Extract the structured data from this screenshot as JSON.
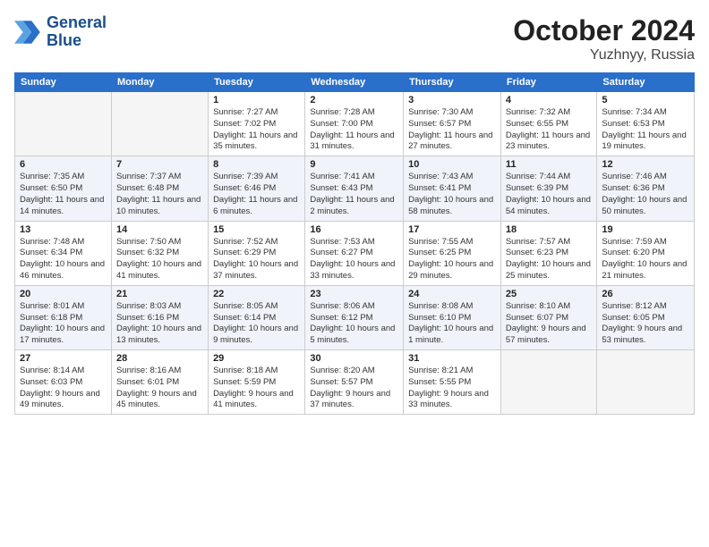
{
  "header": {
    "logo_line1": "General",
    "logo_line2": "Blue",
    "month": "October 2024",
    "location": "Yuzhnyy, Russia"
  },
  "weekdays": [
    "Sunday",
    "Monday",
    "Tuesday",
    "Wednesday",
    "Thursday",
    "Friday",
    "Saturday"
  ],
  "weeks": [
    [
      {
        "day": "",
        "detail": ""
      },
      {
        "day": "",
        "detail": ""
      },
      {
        "day": "1",
        "detail": "Sunrise: 7:27 AM\nSunset: 7:02 PM\nDaylight: 11 hours\nand 35 minutes."
      },
      {
        "day": "2",
        "detail": "Sunrise: 7:28 AM\nSunset: 7:00 PM\nDaylight: 11 hours\nand 31 minutes."
      },
      {
        "day": "3",
        "detail": "Sunrise: 7:30 AM\nSunset: 6:57 PM\nDaylight: 11 hours\nand 27 minutes."
      },
      {
        "day": "4",
        "detail": "Sunrise: 7:32 AM\nSunset: 6:55 PM\nDaylight: 11 hours\nand 23 minutes."
      },
      {
        "day": "5",
        "detail": "Sunrise: 7:34 AM\nSunset: 6:53 PM\nDaylight: 11 hours\nand 19 minutes."
      }
    ],
    [
      {
        "day": "6",
        "detail": "Sunrise: 7:35 AM\nSunset: 6:50 PM\nDaylight: 11 hours\nand 14 minutes."
      },
      {
        "day": "7",
        "detail": "Sunrise: 7:37 AM\nSunset: 6:48 PM\nDaylight: 11 hours\nand 10 minutes."
      },
      {
        "day": "8",
        "detail": "Sunrise: 7:39 AM\nSunset: 6:46 PM\nDaylight: 11 hours\nand 6 minutes."
      },
      {
        "day": "9",
        "detail": "Sunrise: 7:41 AM\nSunset: 6:43 PM\nDaylight: 11 hours\nand 2 minutes."
      },
      {
        "day": "10",
        "detail": "Sunrise: 7:43 AM\nSunset: 6:41 PM\nDaylight: 10 hours\nand 58 minutes."
      },
      {
        "day": "11",
        "detail": "Sunrise: 7:44 AM\nSunset: 6:39 PM\nDaylight: 10 hours\nand 54 minutes."
      },
      {
        "day": "12",
        "detail": "Sunrise: 7:46 AM\nSunset: 6:36 PM\nDaylight: 10 hours\nand 50 minutes."
      }
    ],
    [
      {
        "day": "13",
        "detail": "Sunrise: 7:48 AM\nSunset: 6:34 PM\nDaylight: 10 hours\nand 46 minutes."
      },
      {
        "day": "14",
        "detail": "Sunrise: 7:50 AM\nSunset: 6:32 PM\nDaylight: 10 hours\nand 41 minutes."
      },
      {
        "day": "15",
        "detail": "Sunrise: 7:52 AM\nSunset: 6:29 PM\nDaylight: 10 hours\nand 37 minutes."
      },
      {
        "day": "16",
        "detail": "Sunrise: 7:53 AM\nSunset: 6:27 PM\nDaylight: 10 hours\nand 33 minutes."
      },
      {
        "day": "17",
        "detail": "Sunrise: 7:55 AM\nSunset: 6:25 PM\nDaylight: 10 hours\nand 29 minutes."
      },
      {
        "day": "18",
        "detail": "Sunrise: 7:57 AM\nSunset: 6:23 PM\nDaylight: 10 hours\nand 25 minutes."
      },
      {
        "day": "19",
        "detail": "Sunrise: 7:59 AM\nSunset: 6:20 PM\nDaylight: 10 hours\nand 21 minutes."
      }
    ],
    [
      {
        "day": "20",
        "detail": "Sunrise: 8:01 AM\nSunset: 6:18 PM\nDaylight: 10 hours\nand 17 minutes."
      },
      {
        "day": "21",
        "detail": "Sunrise: 8:03 AM\nSunset: 6:16 PM\nDaylight: 10 hours\nand 13 minutes."
      },
      {
        "day": "22",
        "detail": "Sunrise: 8:05 AM\nSunset: 6:14 PM\nDaylight: 10 hours\nand 9 minutes."
      },
      {
        "day": "23",
        "detail": "Sunrise: 8:06 AM\nSunset: 6:12 PM\nDaylight: 10 hours\nand 5 minutes."
      },
      {
        "day": "24",
        "detail": "Sunrise: 8:08 AM\nSunset: 6:10 PM\nDaylight: 10 hours\nand 1 minute."
      },
      {
        "day": "25",
        "detail": "Sunrise: 8:10 AM\nSunset: 6:07 PM\nDaylight: 9 hours\nand 57 minutes."
      },
      {
        "day": "26",
        "detail": "Sunrise: 8:12 AM\nSunset: 6:05 PM\nDaylight: 9 hours\nand 53 minutes."
      }
    ],
    [
      {
        "day": "27",
        "detail": "Sunrise: 8:14 AM\nSunset: 6:03 PM\nDaylight: 9 hours\nand 49 minutes."
      },
      {
        "day": "28",
        "detail": "Sunrise: 8:16 AM\nSunset: 6:01 PM\nDaylight: 9 hours\nand 45 minutes."
      },
      {
        "day": "29",
        "detail": "Sunrise: 8:18 AM\nSunset: 5:59 PM\nDaylight: 9 hours\nand 41 minutes."
      },
      {
        "day": "30",
        "detail": "Sunrise: 8:20 AM\nSunset: 5:57 PM\nDaylight: 9 hours\nand 37 minutes."
      },
      {
        "day": "31",
        "detail": "Sunrise: 8:21 AM\nSunset: 5:55 PM\nDaylight: 9 hours\nand 33 minutes."
      },
      {
        "day": "",
        "detail": ""
      },
      {
        "day": "",
        "detail": ""
      }
    ]
  ]
}
